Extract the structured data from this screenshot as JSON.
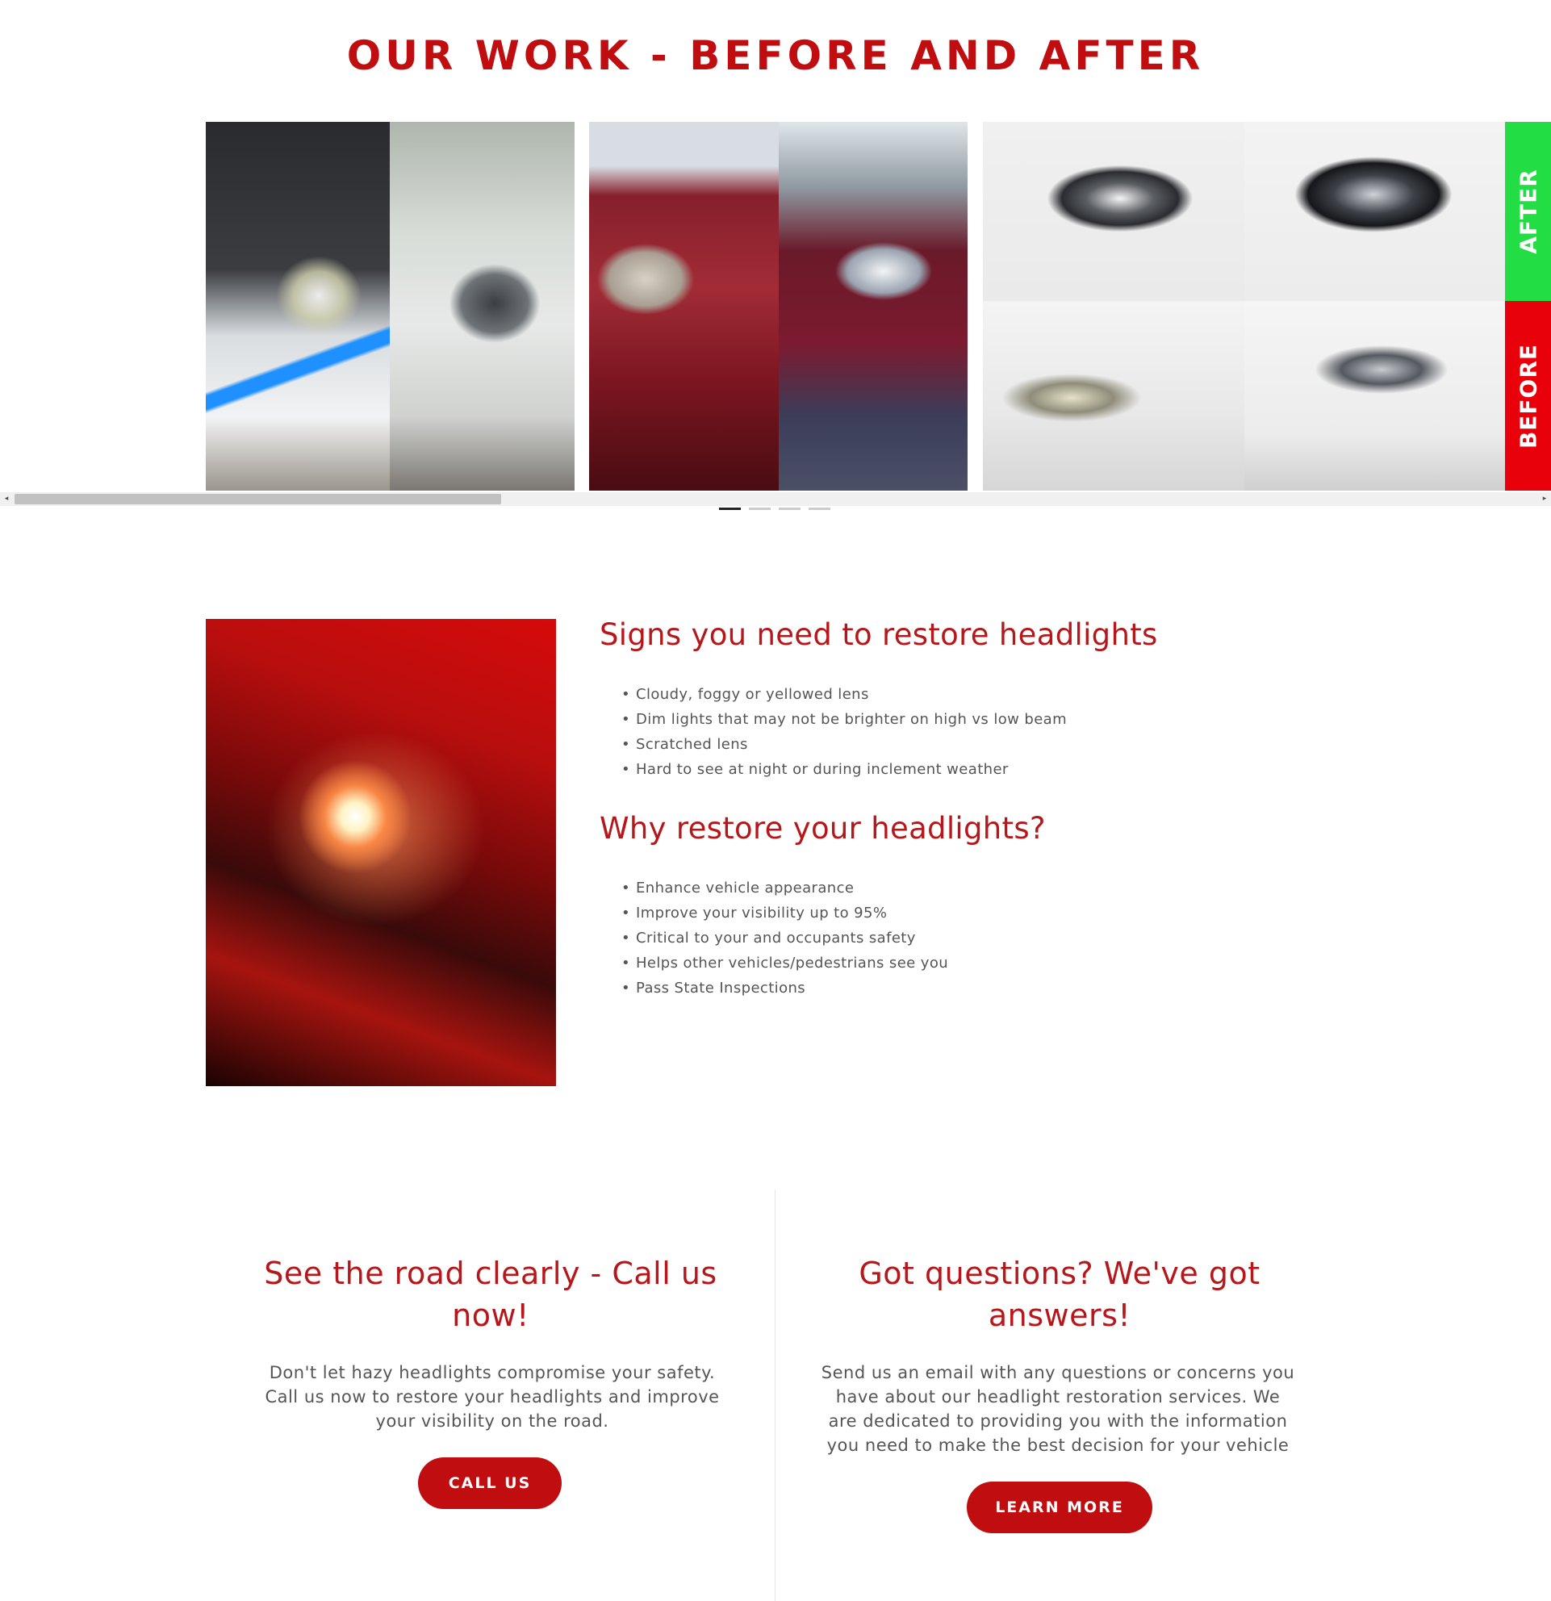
{
  "gallery": {
    "title": "OUR WORK - BEFORE AND AFTER",
    "after_label": "AFTER",
    "before_label": "BEFORE",
    "scroll_left_glyph": "◂",
    "scroll_right_glyph": "▸",
    "dots_count": 4,
    "active_dot": 1
  },
  "signs": {
    "title": "Signs you need to restore headlights",
    "items": [
      "Cloudy, foggy or yellowed lens",
      "Dim lights that may not be brighter on high vs low beam",
      "Scratched lens",
      "Hard to see at night or during inclement weather"
    ]
  },
  "why": {
    "title": "Why restore your headlights?",
    "items": [
      "Enhance vehicle appearance",
      "Improve your visibility up to 95%",
      "Critical to your and occupants safety",
      "Helps other vehicles/pedestrians see you",
      "Pass State Inspections"
    ]
  },
  "cta_call": {
    "title": "See the road clearly - Call us now!",
    "text": "Don't let hazy headlights compromise your safety. Call us now to restore your headlights and improve your visibility on the road.",
    "button_label": "CALL US"
  },
  "cta_questions": {
    "title": "Got questions? We've got answers!",
    "text": "Send us an email with any questions or concerns you have about our headlight restoration services. We are dedicated to providing you with the information you need to make the best decision for your vehicle",
    "button_label": "LEARN MORE"
  },
  "colors": {
    "brand_red": "#c00d10",
    "after_green": "#22dd44",
    "before_red": "#e8000b"
  }
}
